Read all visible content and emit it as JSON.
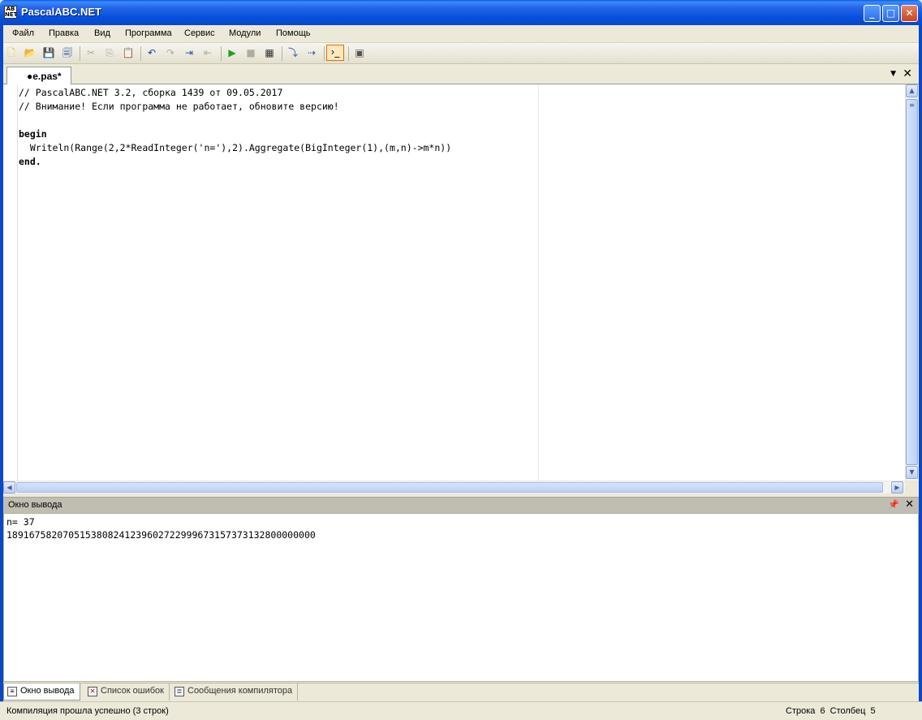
{
  "window": {
    "title": "PascalABC.NET",
    "icon": "pascalabc-app-icon"
  },
  "menu": [
    "Файл",
    "Правка",
    "Вид",
    "Программа",
    "Сервис",
    "Модули",
    "Помощь"
  ],
  "toolbar": {
    "icons": [
      "new-file-icon",
      "open-icon",
      "save-icon",
      "save-all-icon",
      "cut-icon",
      "copy-icon",
      "paste-icon",
      "undo-icon",
      "redo-icon",
      "indent-icon",
      "unindent-icon",
      "run-icon",
      "stop-icon",
      "compile-icon",
      "debug-icon",
      "step-icon",
      "console-output-icon",
      "form-icon"
    ]
  },
  "editor": {
    "tab_label": "●e.pas*",
    "lines": [
      "// PascalABC.NET 3.2, сборка 1439 от 09.05.2017",
      "// Внимание! Если программа не работает, обновите версию!",
      "",
      "begin",
      "  Writeln(Range(2,2*ReadInteger('n='),2).Aggregate(BigInteger(1),(m,n)->m*n))",
      "end."
    ]
  },
  "output_panel": {
    "title": "Окно вывода",
    "lines": [
      "n= 37",
      "1891675820705153808241239602722999673157373132800000000"
    ]
  },
  "bottom_tabs": [
    "Окно вывода",
    "Список ошибок",
    "Сообщения компилятора"
  ],
  "status": {
    "message": "Компиляция прошла успешно (3 строк)",
    "line_label": "Строка",
    "line": "6",
    "col_label": "Столбец",
    "col": "5"
  },
  "colors": {
    "titlebar": "#0450dc",
    "comment": "#008000",
    "number": "#00008b",
    "string": "#a0007a"
  }
}
